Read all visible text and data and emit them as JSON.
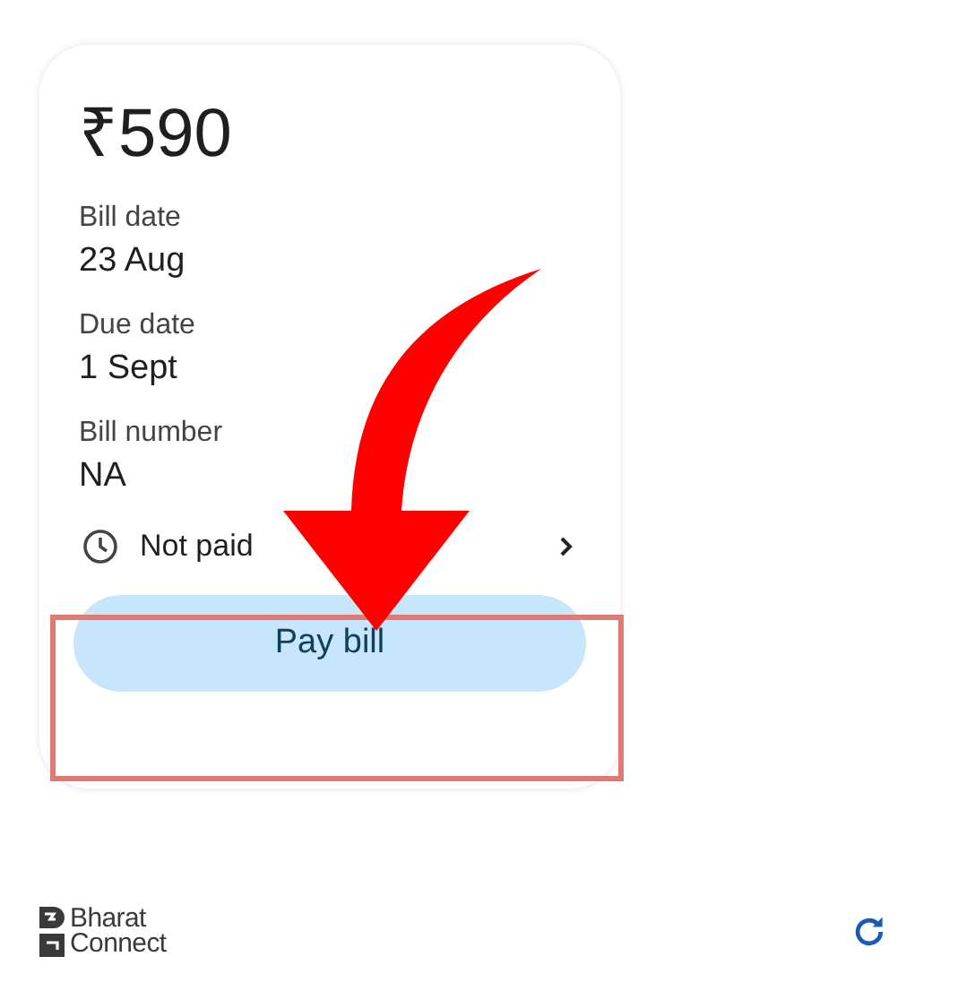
{
  "bill": {
    "amount": "₹590",
    "fields": [
      {
        "label": "Bill date",
        "value": "23 Aug"
      },
      {
        "label": "Due date",
        "value": "1 Sept"
      },
      {
        "label": "Bill number",
        "value": "NA"
      }
    ],
    "status": {
      "label": "Not paid"
    },
    "pay_button": {
      "label": "Pay bill"
    }
  },
  "footer": {
    "logo_lines": [
      "Bharat",
      "Connect"
    ]
  }
}
